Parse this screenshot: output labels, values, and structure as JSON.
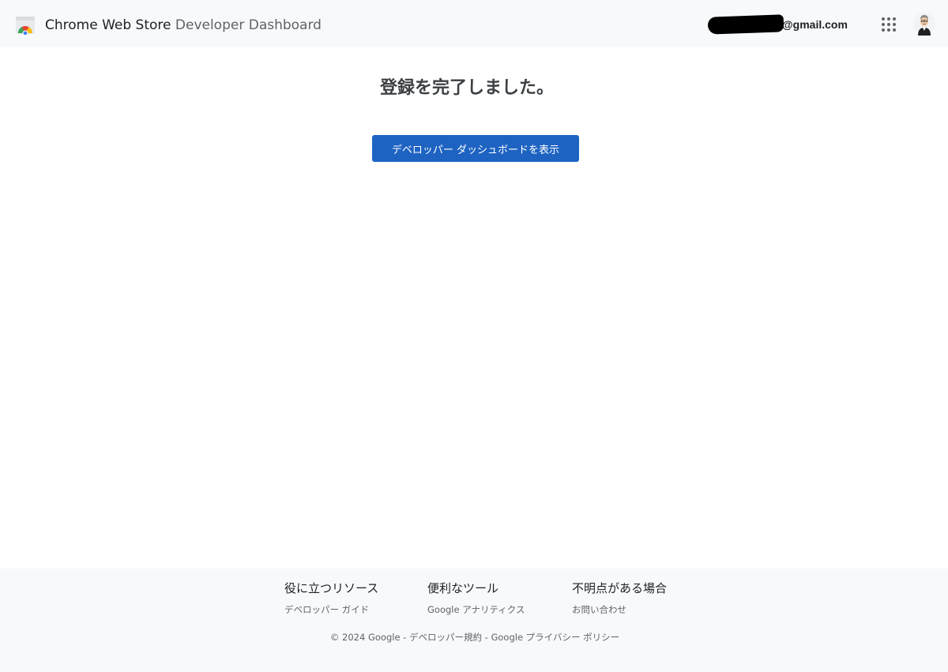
{
  "header": {
    "brand_main": "Chrome Web Store",
    "brand_sub": "Developer Dashboard",
    "email_domain": "@gmail.com",
    "apps_icon": "apps-grid-icon",
    "avatar_icon": "user-avatar"
  },
  "main": {
    "title": "登録を完了しました。",
    "button_label": "デベロッパー ダッシュボードを表示",
    "button_color": "#1e63c2"
  },
  "footer": {
    "columns": [
      {
        "heading": "役に立つリソース",
        "link": "デベロッパー ガイド"
      },
      {
        "heading": "便利なツール",
        "link": "Google アナリティクス"
      },
      {
        "heading": "不明点がある場合",
        "link": "お問い合わせ"
      }
    ],
    "copyright": "© 2024 Google",
    "sep": " - ",
    "terms": "デベロッパー規約",
    "privacy": "Google プライバシー ポリシー"
  }
}
